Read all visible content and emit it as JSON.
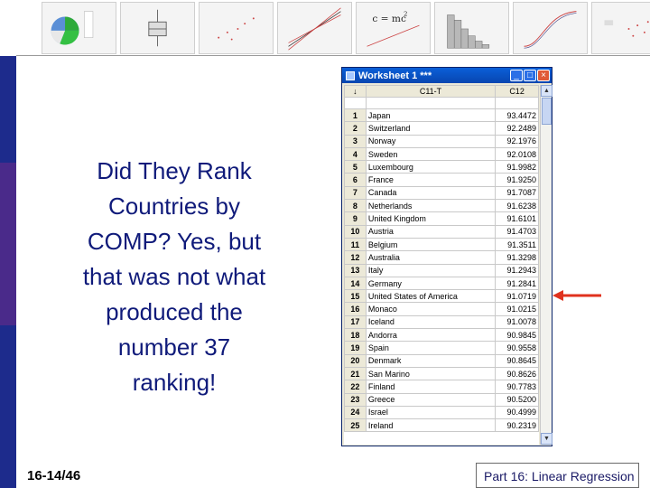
{
  "slide": {
    "text_lines": [
      "Did They Rank",
      "Countries by",
      "COMP?   Yes, but",
      "that was not what",
      "produced the",
      "number 37",
      "ranking!"
    ],
    "slide_number": "16-14/46",
    "footer": "Part 16: Linear Regression"
  },
  "worksheet": {
    "title": "Worksheet 1 ***",
    "columns": [
      "↓",
      "C11-T",
      "C12"
    ],
    "rows": [
      {
        "n": "1",
        "country": "Japan",
        "value": "93.4472"
      },
      {
        "n": "2",
        "country": "Switzerland",
        "value": "92.2489"
      },
      {
        "n": "3",
        "country": "Norway",
        "value": "92.1976"
      },
      {
        "n": "4",
        "country": "Sweden",
        "value": "92.0108"
      },
      {
        "n": "5",
        "country": "Luxembourg",
        "value": "91.9982"
      },
      {
        "n": "6",
        "country": "France",
        "value": "91.9250"
      },
      {
        "n": "7",
        "country": "Canada",
        "value": "91.7087"
      },
      {
        "n": "8",
        "country": "Netherlands",
        "value": "91.6238"
      },
      {
        "n": "9",
        "country": "United Kingdom",
        "value": "91.6101"
      },
      {
        "n": "10",
        "country": "Austria",
        "value": "91.4703"
      },
      {
        "n": "11",
        "country": "Belgium",
        "value": "91.3511"
      },
      {
        "n": "12",
        "country": "Australia",
        "value": "91.3298"
      },
      {
        "n": "13",
        "country": "Italy",
        "value": "91.2943"
      },
      {
        "n": "14",
        "country": "Germany",
        "value": "91.2841"
      },
      {
        "n": "15",
        "country": "United States of America",
        "value": "91.0719"
      },
      {
        "n": "16",
        "country": "Monaco",
        "value": "91.0215"
      },
      {
        "n": "17",
        "country": "Iceland",
        "value": "91.0078"
      },
      {
        "n": "18",
        "country": "Andorra",
        "value": "90.9845"
      },
      {
        "n": "19",
        "country": "Spain",
        "value": "90.9558"
      },
      {
        "n": "20",
        "country": "Denmark",
        "value": "90.8645"
      },
      {
        "n": "21",
        "country": "San Marino",
        "value": "90.8626"
      },
      {
        "n": "22",
        "country": "Finland",
        "value": "90.7783"
      },
      {
        "n": "23",
        "country": "Greece",
        "value": "90.5200"
      },
      {
        "n": "24",
        "country": "Israel",
        "value": "90.4999"
      },
      {
        "n": "25",
        "country": "Ireland",
        "value": "90.2319"
      }
    ]
  },
  "banner": {
    "formula": "c = mc",
    "formula_exp": "2"
  },
  "colors": {
    "accent_bar": "#1d2b8c",
    "slide_text": "#0f1a7a",
    "arrow": "#e0321e"
  }
}
